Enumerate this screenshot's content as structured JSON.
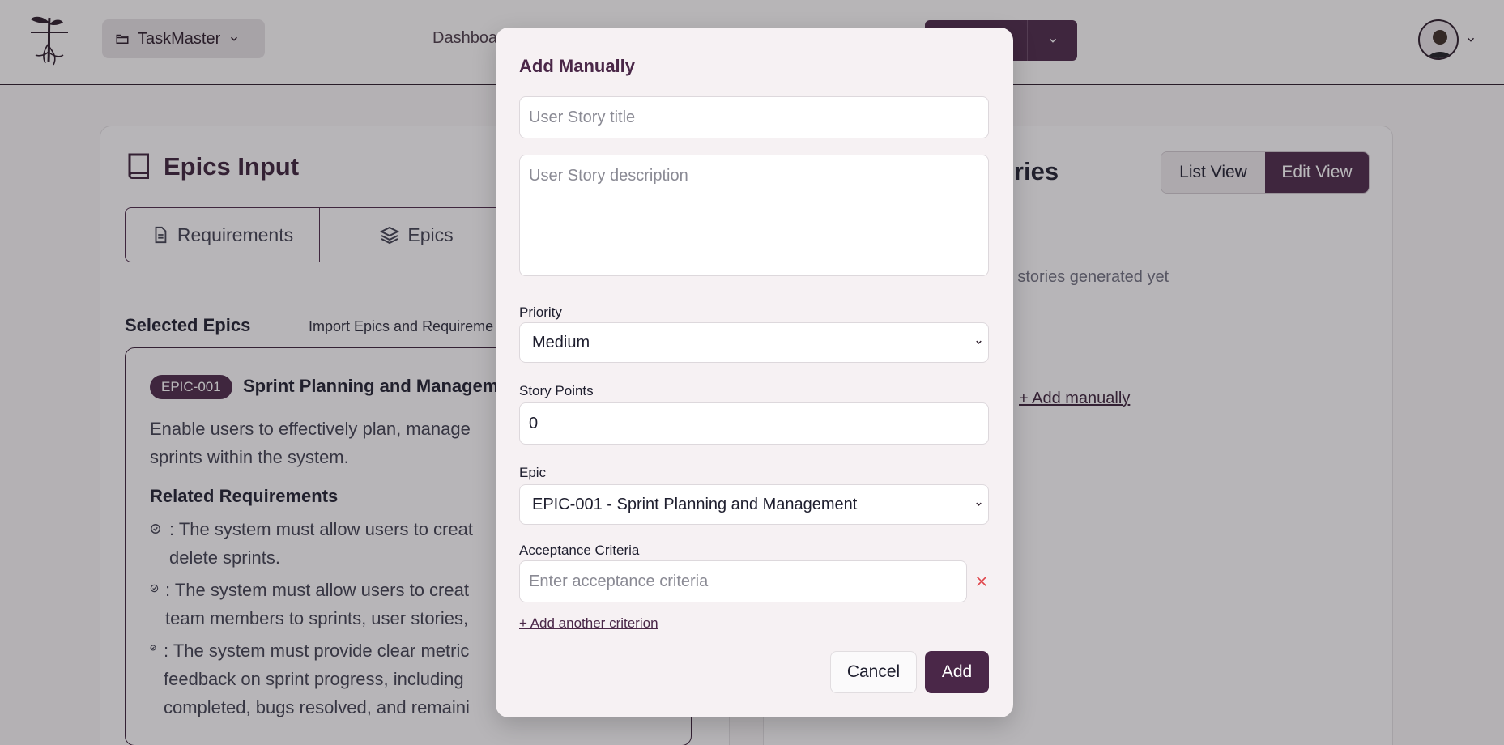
{
  "header": {
    "project_name": "TaskMaster",
    "nav_link": "Dashboa"
  },
  "left_panel": {
    "title": "Epics Input",
    "tabs": [
      "Requirements",
      "Epics"
    ],
    "selected_title": "Selected Epics",
    "import_link": "Import Epics and Requireme",
    "epic": {
      "badge": "EPIC-001",
      "name": "Sprint Planning and Managem",
      "description": "Enable users to effectively plan, manage sprints within the system.",
      "description_lines": [
        "Enable users to effectively plan, manage",
        "sprints within the system."
      ],
      "related_title": "Related Requirements",
      "requirements": [
        {
          "lines": [
            ": The system must allow users to creat",
            "delete sprints."
          ]
        },
        {
          "lines": [
            ": The system must allow users to creat",
            "team members to sprints, user stories,"
          ]
        },
        {
          "lines": [
            ": The system must provide clear metric",
            "feedback on sprint progress, including",
            "completed, bugs resolved, and remaini"
          ]
        }
      ]
    }
  },
  "right_panel": {
    "title_partial": "ories",
    "view_toggle": {
      "list": "List View",
      "edit": "Edit View"
    },
    "empty_text": "er stories generated yet",
    "add_manually": "+ Add manually"
  },
  "modal": {
    "title": "Add Manually",
    "story_title_placeholder": "User Story title",
    "story_description_placeholder": "User Story description",
    "priority_label": "Priority",
    "priority_value": "Medium",
    "story_points_label": "Story Points",
    "story_points_value": "0",
    "epic_label": "Epic",
    "epic_value": "EPIC-001 - Sprint Planning and Management",
    "acceptance_label": "Acceptance Criteria",
    "acceptance_placeholder": "Enter acceptance criteria",
    "add_criterion": "+ Add another criterion",
    "cancel": "Cancel",
    "add": "Add"
  },
  "colors": {
    "brand": "#4a2748",
    "remove": "#e0454a"
  },
  "icons": {
    "logo": "sprout-logo-icon",
    "folder": "folder-icon",
    "book": "book-icon",
    "document": "document-icon",
    "layers": "layers-icon",
    "close": "close-icon"
  }
}
